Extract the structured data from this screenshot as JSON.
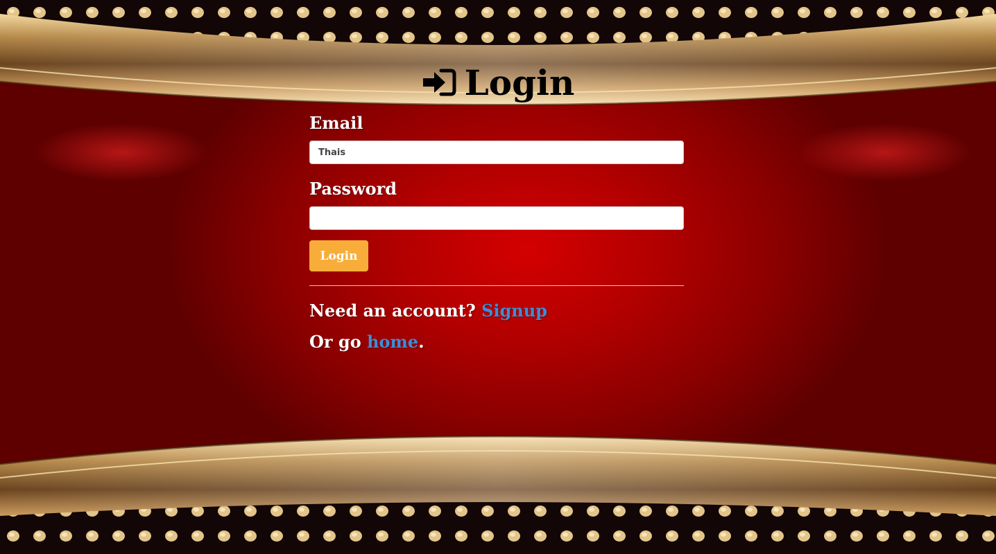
{
  "page": {
    "title": "Login",
    "icon": "sign-in-icon"
  },
  "form": {
    "email_label": "Email",
    "email_value": "Thais",
    "password_label": "Password",
    "password_value": "",
    "login_button": "Login"
  },
  "footer": {
    "signup_prompt": "Need an account?",
    "signup_link": "Signup",
    "home_prefix": "Or go",
    "home_link": "home",
    "home_suffix": "."
  },
  "colors": {
    "background_red": "#b30000",
    "gold_band": "#c9a060",
    "button": "#f8ad3a",
    "link": "#3a8fd8"
  }
}
